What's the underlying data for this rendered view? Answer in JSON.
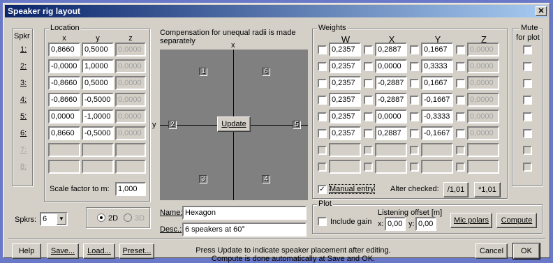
{
  "window": {
    "title": "Speaker rig layout",
    "close_label": "✕"
  },
  "speakers": {
    "spkr_header": "Spkr",
    "location_label": "Location",
    "loc_cols": [
      "x",
      "y",
      "z"
    ],
    "rows": [
      {
        "label": "1:",
        "x": "0,8660",
        "y": "0,5000",
        "z": "0,0000",
        "enabled": true
      },
      {
        "label": "2:",
        "x": "-0,0000",
        "y": "1,0000",
        "z": "0,0000",
        "enabled": true
      },
      {
        "label": "3:",
        "x": "-0,8660",
        "y": "0,5000",
        "z": "0,0000",
        "enabled": true
      },
      {
        "label": "4:",
        "x": "-0,8660",
        "y": "-0,5000",
        "z": "0,0000",
        "enabled": true
      },
      {
        "label": "5:",
        "x": "0,0000",
        "y": "-1,0000",
        "z": "0,0000",
        "enabled": true
      },
      {
        "label": "6:",
        "x": "0,8660",
        "y": "-0,5000",
        "z": "0,0000",
        "enabled": true
      },
      {
        "label": "7:",
        "x": "",
        "y": "",
        "z": "",
        "enabled": false
      },
      {
        "label": "8:",
        "x": "",
        "y": "",
        "z": "",
        "enabled": false
      }
    ],
    "scale_label": "Scale factor to m:",
    "scale_value": "1,000"
  },
  "plot_view": {
    "note": "Compensation for unequal radii is made separately",
    "axis_x": "x",
    "axis_y": "y",
    "update_label": "Update",
    "markers": [
      "1",
      "6",
      "2",
      "5",
      "3",
      "4"
    ]
  },
  "weights": {
    "label": "Weights",
    "cols": [
      "W",
      "X",
      "Y",
      "Z"
    ],
    "rows": [
      [
        "0,2357",
        "0,2887",
        "0,1667",
        "0,0000"
      ],
      [
        "0,2357",
        "0,0000",
        "0,3333",
        "0,0000"
      ],
      [
        "0,2357",
        "-0,2887",
        "0,1667",
        "0,0000"
      ],
      [
        "0,2357",
        "-0,2887",
        "-0,1667",
        "0,0000"
      ],
      [
        "0,2357",
        "0,0000",
        "-0,3333",
        "0,0000"
      ],
      [
        "0,2357",
        "0,2887",
        "-0,1667",
        "0,0000"
      ],
      [
        "",
        "",
        "",
        ""
      ],
      [
        "",
        "",
        "",
        ""
      ]
    ],
    "manual_entry": "Manual entry",
    "alter_checked": "Alter checked:",
    "btn_div": "/1,01",
    "btn_mul": "*1,01"
  },
  "mute": {
    "label_line1": "Mute",
    "label_line2": "for plot"
  },
  "bottom": {
    "spkrs_label": "Spkrs:",
    "spkrs_value": "6",
    "mode_2d": "2D",
    "mode_3d": "3D",
    "name_label": "Name:",
    "name_value": "Hexagon",
    "desc_label": "Desc.:",
    "desc_value": "6 speakers at 60°"
  },
  "plot_group": {
    "label": "Plot",
    "include_gain": "Include gain",
    "offset_label": "Listening offset [m]",
    "x_label": "x:",
    "x_value": "0,00",
    "y_label": "y:",
    "y_value": "0,00",
    "mic_polars": "Mic polars",
    "compute": "Compute"
  },
  "footer": {
    "help": "Help",
    "save": "Save...",
    "load": "Load...",
    "preset": "Preset...",
    "status_line1": "Press Update to indicate speaker placement after editing.",
    "status_line2": "Compute is done automatically at Save and OK.",
    "cancel": "Cancel",
    "ok": "OK"
  }
}
